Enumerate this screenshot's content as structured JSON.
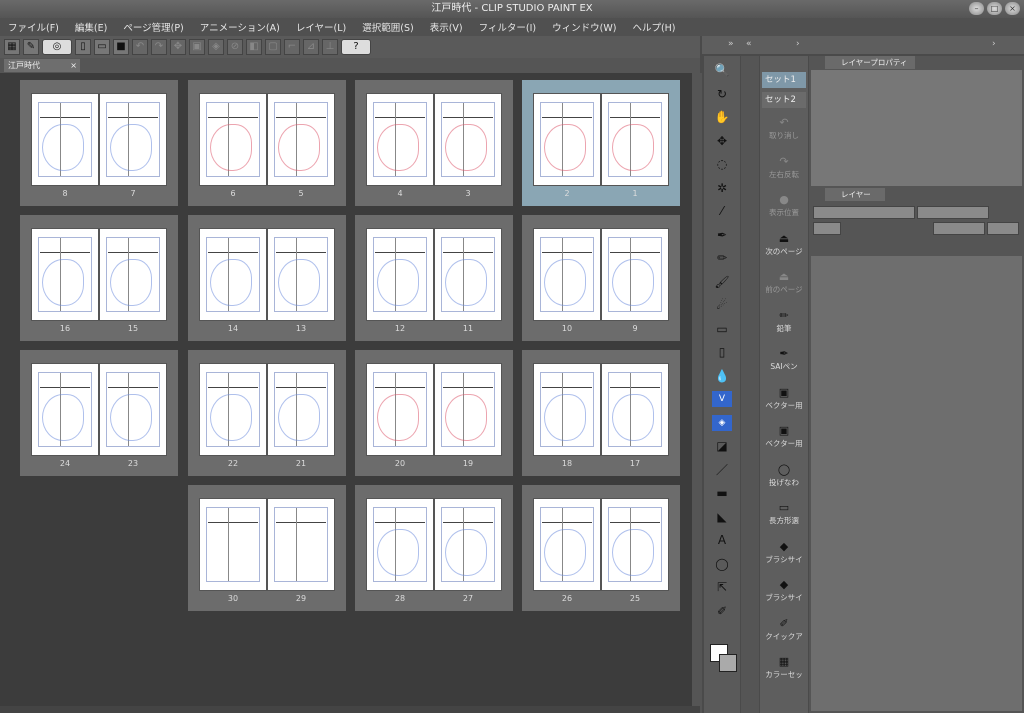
{
  "window": {
    "title": "江戸時代 - CLIP STUDIO PAINT EX",
    "controls": [
      "–",
      "□",
      "×"
    ]
  },
  "menu": [
    "ファイル(F)",
    "編集(E)",
    "ページ管理(P)",
    "アニメーション(A)",
    "レイヤー(L)",
    "選択範囲(S)",
    "表示(V)",
    "フィルター(I)",
    "ウィンドウ(W)",
    "ヘルプ(H)"
  ],
  "doc_tab": {
    "label": "江戸時代",
    "close": "×"
  },
  "spreads": [
    {
      "left": "8",
      "right": "7",
      "selected": false,
      "sketch": "blue"
    },
    {
      "left": "6",
      "right": "5",
      "selected": false,
      "sketch": "red"
    },
    {
      "left": "4",
      "right": "3",
      "selected": false,
      "sketch": "red"
    },
    {
      "left": "2",
      "right": "1",
      "selected": true,
      "sketch": "red"
    },
    {
      "left": "16",
      "right": "15",
      "selected": false,
      "sketch": "blue"
    },
    {
      "left": "14",
      "right": "13",
      "selected": false,
      "sketch": "blue"
    },
    {
      "left": "12",
      "right": "11",
      "selected": false,
      "sketch": "blue"
    },
    {
      "left": "10",
      "right": "9",
      "selected": false,
      "sketch": "blue"
    },
    {
      "left": "24",
      "right": "23",
      "selected": false,
      "sketch": "blue"
    },
    {
      "left": "22",
      "right": "21",
      "selected": false,
      "sketch": "blue"
    },
    {
      "left": "20",
      "right": "19",
      "selected": false,
      "sketch": "red"
    },
    {
      "left": "18",
      "right": "17",
      "selected": false,
      "sketch": "blue"
    },
    {
      "left": "30",
      "right": "29",
      "selected": false,
      "sketch": "none"
    },
    {
      "left": "28",
      "right": "27",
      "selected": false,
      "sketch": "blue"
    },
    {
      "left": "26",
      "right": "25",
      "selected": false,
      "sketch": "blue"
    }
  ],
  "tools_icons": [
    "zoom-icon",
    "rotate-icon",
    "hand-icon",
    "move-icon",
    "lasso-icon",
    "auto-select-icon",
    "eyedropper-icon",
    "pen-icon",
    "pencil-icon",
    "brush-icon",
    "airbrush-icon",
    "vector-eraser-icon",
    "eraser-icon",
    "blend-icon",
    "vector-tool-icon",
    "fill-icon",
    "gradient-icon",
    "figure-icon",
    "frame-icon",
    "ruler-icon",
    "text-icon",
    "balloon-icon",
    "link-icon",
    "correct-icon"
  ],
  "sets": [
    "セット1",
    "セット2"
  ],
  "subtools": [
    {
      "label": "取り消し",
      "dim": true
    },
    {
      "label": "左右反転",
      "dim": true
    },
    {
      "label": "表示位置",
      "dim": true
    },
    {
      "label": "次のページ",
      "dim": false
    },
    {
      "label": "前のページ",
      "dim": true
    },
    {
      "label": "鉛筆",
      "dim": false
    },
    {
      "label": "SAIペン",
      "dim": false
    },
    {
      "label": "ベクター用",
      "dim": false
    },
    {
      "label": "ベクター用",
      "dim": false
    },
    {
      "label": "投げなわ",
      "dim": false
    },
    {
      "label": "長方形選",
      "dim": false
    },
    {
      "label": "ブラシサイ",
      "dim": false
    },
    {
      "label": "ブラシサイ",
      "dim": false
    },
    {
      "label": "クイックア",
      "dim": false
    },
    {
      "label": "カラーセッ",
      "dim": false
    }
  ],
  "right_panel": {
    "layer_property_tab": "レイヤープロパティ",
    "layer_tab": "レイヤー",
    "layer_tab2": ""
  }
}
